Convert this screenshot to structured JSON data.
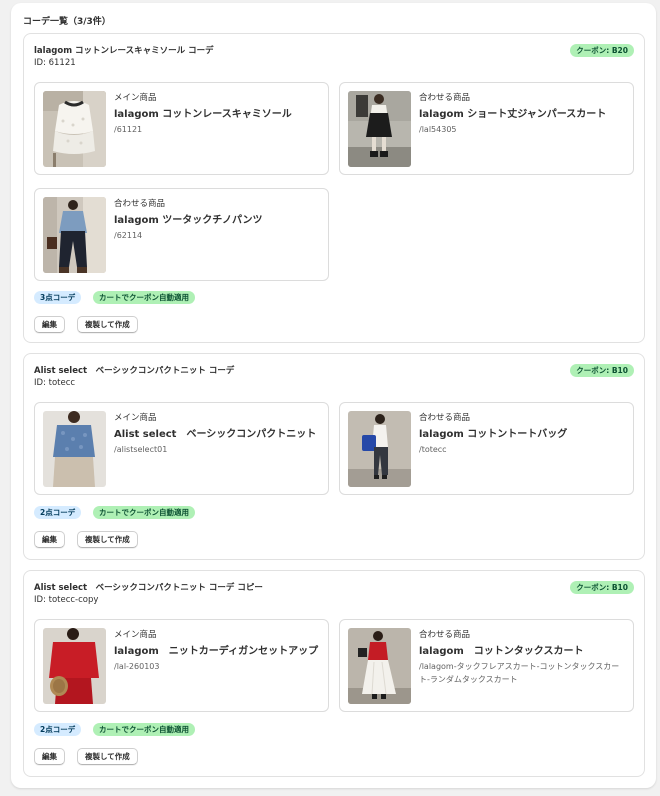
{
  "list": {
    "title": "コーデ一覧（3/3件）"
  },
  "cards": [
    {
      "title": "lalagom コットンレースキャミソール コーデ",
      "id": "ID: 61121",
      "coupon": "クーポン: B20",
      "products": [
        {
          "role": "メイン商品",
          "name": "lalagom コットンレースキャミソール",
          "handle": "/61121",
          "image": "white-lace-camisole-photo"
        },
        {
          "role": "合わせる商品",
          "name": "lalagom ショート丈ジャンパースカート",
          "handle": "/lal54305",
          "image": "black-jumper-skirt-photo"
        },
        {
          "role": "合わせる商品",
          "name": "lalagom ツータックチノパンツ",
          "handle": "/62114",
          "image": "navy-chino-pants-photo"
        }
      ],
      "badges": {
        "count": "3点コーデ",
        "coupon_auto": "カートでクーポン自動適用"
      },
      "actions": {
        "edit": "編集",
        "duplicate": "複製して作成"
      }
    },
    {
      "title": "Alist select　ベーシックコンパクトニット コーデ",
      "id": "ID: totecc",
      "coupon": "クーポン: B10",
      "products": [
        {
          "role": "メイン商品",
          "name": "Alist select　ベーシックコンパクトニット",
          "handle": "/alistselect01",
          "image": "blue-knit-photo"
        },
        {
          "role": "合わせる商品",
          "name": "lalagom コットントートバッグ",
          "handle": "/totecc",
          "image": "tote-bag-outfit-photo"
        }
      ],
      "badges": {
        "count": "2点コーデ",
        "coupon_auto": "カートでクーポン自動適用"
      },
      "actions": {
        "edit": "編集",
        "duplicate": "複製して作成"
      }
    },
    {
      "title": "Alist select　ベーシックコンパクトニット コーデ コピー",
      "id": "ID: totecc-copy",
      "coupon": "クーポン: B10",
      "products": [
        {
          "role": "メイン商品",
          "name": "lalagom　ニットカーディガンセットアップ",
          "handle": "/lal-260103",
          "image": "red-cardigan-photo"
        },
        {
          "role": "合わせる商品",
          "name": "lalagom　コットンタックスカート",
          "handle": "/lalagom-タックフレアスカート-コットンタックスカート-ランダムタックスカート",
          "image": "white-tuck-skirt-photo"
        }
      ],
      "badges": {
        "count": "2点コーデ",
        "coupon_auto": "カートでクーポン自動適用"
      },
      "actions": {
        "edit": "編集",
        "duplicate": "複製して作成"
      }
    }
  ],
  "colors": {
    "coupon_bg": "#aff0b5",
    "info_badge_bg": "#d5ebff",
    "page_bg": "#f1f1f1"
  }
}
